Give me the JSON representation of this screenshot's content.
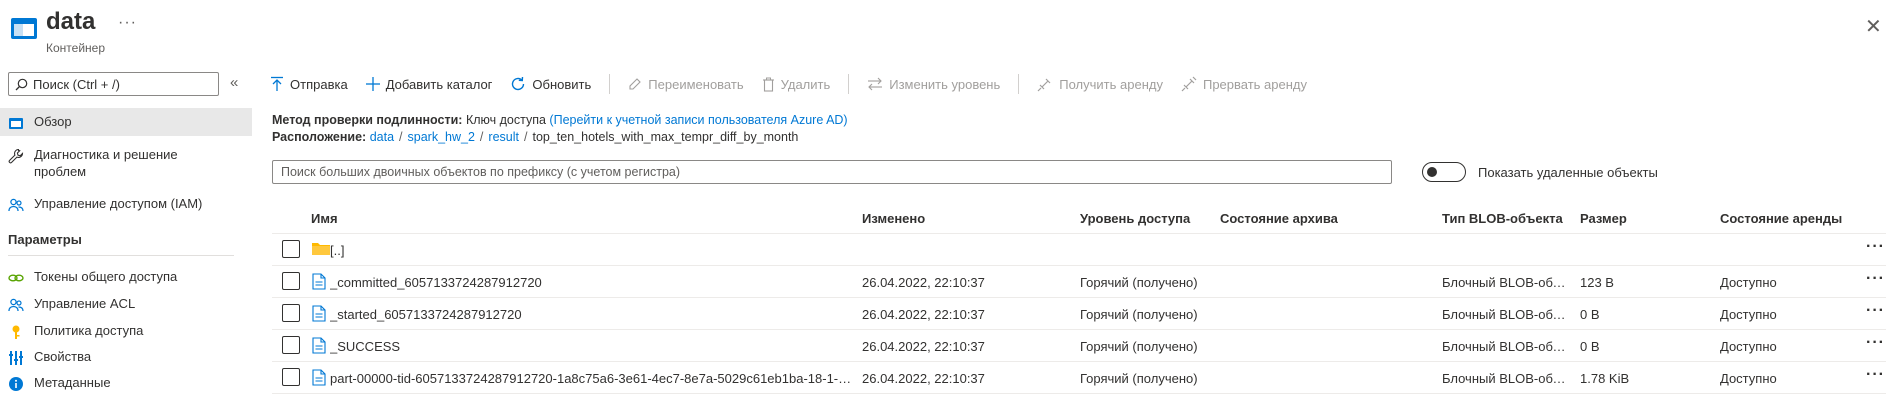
{
  "header": {
    "title": "data",
    "subtitle": "Контейнер",
    "more": "···",
    "close": "✕"
  },
  "sidebar": {
    "search_placeholder": "Поиск (Ctrl + /)",
    "collapse": "«",
    "items": [
      {
        "label": "Обзор",
        "icon": "overview-icon"
      },
      {
        "label": "Диагностика и решение проблем",
        "icon": "wrench-icon"
      },
      {
        "label": "Управление доступом (IAM)",
        "icon": "people-icon"
      }
    ],
    "section_title": "Параметры",
    "settings_items": [
      {
        "label": "Токены общего доступа",
        "icon": "link-icon"
      },
      {
        "label": "Управление ACL",
        "icon": "people-icon"
      },
      {
        "label": "Политика доступа",
        "icon": "key-icon"
      },
      {
        "label": "Свойства",
        "icon": "properties-icon"
      },
      {
        "label": "Метаданные",
        "icon": "info-icon"
      }
    ]
  },
  "toolbar": {
    "upload": "Отправка",
    "add_directory": "Добавить каталог",
    "refresh": "Обновить",
    "rename": "Переименовать",
    "delete": "Удалить",
    "change_tier": "Изменить уровень",
    "acquire_lease": "Получить аренду",
    "break_lease": "Прервать аренду"
  },
  "info": {
    "auth_label": "Метод проверки подлинности:",
    "auth_value": "Ключ доступа",
    "auth_link": "(Перейти к учетной записи пользователя Azure AD)",
    "location_label": "Расположение:",
    "breadcrumb": [
      "data",
      "spark_hw_2",
      "result",
      "top_ten_hotels_with_max_tempr_diff_by_month"
    ]
  },
  "filter": {
    "placeholder": "Поиск больших двоичных объектов по префиксу (с учетом регистра)",
    "toggle_label": "Показать удаленные объекты",
    "toggle_on": false
  },
  "table": {
    "columns": [
      "Имя",
      "Изменено",
      "Уровень доступа",
      "Состояние архива",
      "Тип BLOB-объекта",
      "Размер",
      "Состояние аренды"
    ],
    "rows": [
      {
        "name": "[..]",
        "type": "folder",
        "modified": "",
        "tier": "",
        "archive": "",
        "blob_type": "",
        "size": "",
        "lease": ""
      },
      {
        "name": "_committed_6057133724287912720",
        "type": "file",
        "modified": "26.04.2022, 22:10:37",
        "tier": "Горячий (получено)",
        "archive": "",
        "blob_type": "Блочный BLOB-объ...",
        "size": "123 B",
        "lease": "Доступно"
      },
      {
        "name": "_started_6057133724287912720",
        "type": "file",
        "modified": "26.04.2022, 22:10:37",
        "tier": "Горячий (получено)",
        "archive": "",
        "blob_type": "Блочный BLOB-объ...",
        "size": "0 B",
        "lease": "Доступно"
      },
      {
        "name": "_SUCCESS",
        "type": "file",
        "modified": "26.04.2022, 22:10:37",
        "tier": "Горячий (получено)",
        "archive": "",
        "blob_type": "Блочный BLOB-объ...",
        "size": "0 B",
        "lease": "Доступно"
      },
      {
        "name": "part-00000-tid-6057133724287912720-1a8c75a6-3e61-4ec7-8e7a-5029c61eb1ba-18-1-c...",
        "type": "file",
        "modified": "26.04.2022, 22:10:37",
        "tier": "Горячий (получено)",
        "archive": "",
        "blob_type": "Блочный BLOB-объ...",
        "size": "1.78 KiB",
        "lease": "Доступно"
      }
    ],
    "row_more": "···"
  },
  "colors": {
    "accent": "#0078d4",
    "folder": "#ffb900",
    "text": "#323130",
    "disabled": "#a19f9d"
  }
}
